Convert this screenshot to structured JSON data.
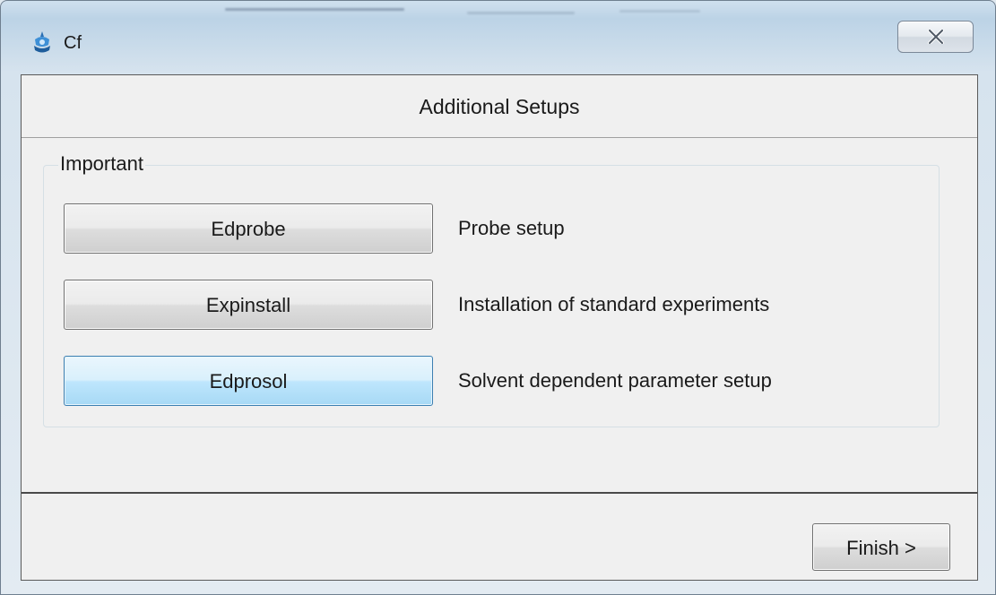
{
  "window": {
    "title": "Cf",
    "icon": "cf-app-icon",
    "close_icon": "close-x-icon"
  },
  "header": {
    "title": "Additional Setups"
  },
  "group": {
    "legend": "Important",
    "actions": [
      {
        "label": "Edprobe",
        "description": "Probe setup",
        "focused": false
      },
      {
        "label": "Expinstall",
        "description": "Installation of standard experiments",
        "focused": false
      },
      {
        "label": "Edprosol",
        "description": "Solvent dependent parameter setup",
        "focused": true
      }
    ]
  },
  "footer": {
    "finish_label": "Finish >"
  },
  "colors": {
    "focused_button": "#bee6fd",
    "focused_border": "#3c7fb1",
    "dialog_background": "#f0f0f0"
  }
}
